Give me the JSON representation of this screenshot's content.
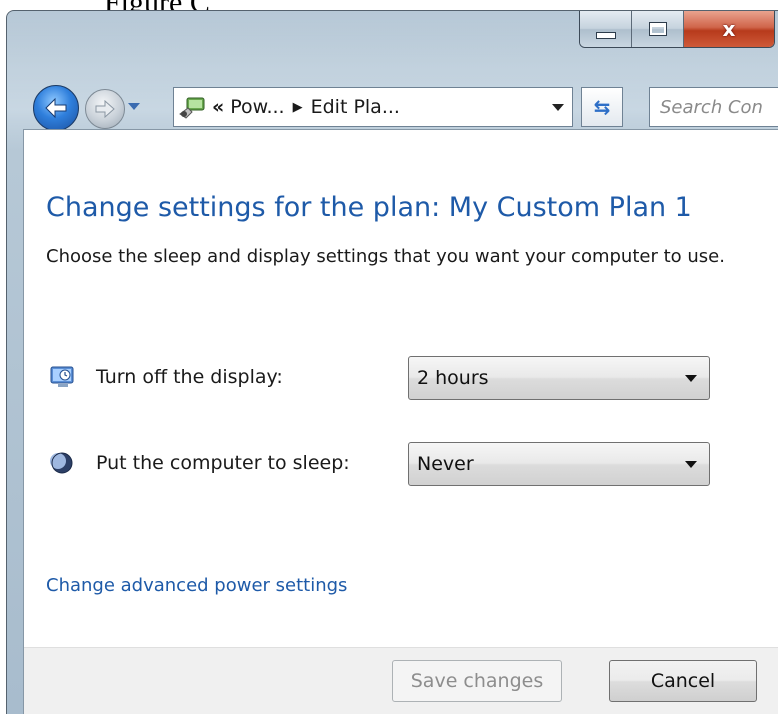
{
  "figure": {
    "caption": "Figure C"
  },
  "titlebar": {
    "buttons": {
      "minimize": "minimize-icon",
      "maximize": "maximize-icon",
      "close_glyph": "x"
    }
  },
  "nav": {
    "back_icon": "back-arrow-icon",
    "forward_icon": "forward-arrow-icon",
    "address": {
      "overflow": "«",
      "crumbs": [
        "Pow...",
        "Edit Pla..."
      ]
    },
    "search_placeholder": "Search Con"
  },
  "content": {
    "title": "Change settings for the plan: My Custom Plan 1",
    "description": "Choose the sleep and display settings that you want your computer to use.",
    "settings": [
      {
        "label": "Turn off the display:",
        "value": "2 hours",
        "icon": "display-monitor-icon"
      },
      {
        "label": "Put the computer to sleep:",
        "value": "Never",
        "icon": "sleep-moon-icon"
      }
    ],
    "advanced_link": "Change advanced power settings"
  },
  "footer": {
    "save_label": "Save changes",
    "cancel_label": "Cancel"
  },
  "colors": {
    "title_blue": "#1e5aa8",
    "link_blue": "#1e5aa8",
    "close_red": "#c9462a"
  }
}
